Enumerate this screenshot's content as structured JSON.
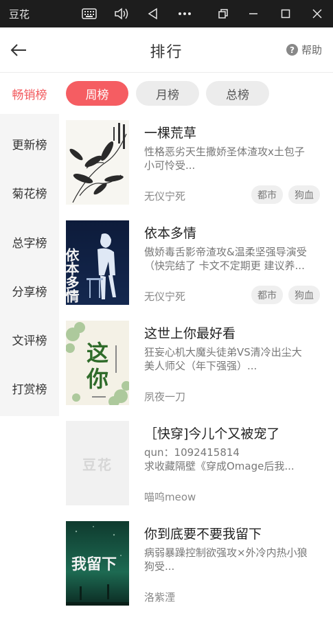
{
  "emulator": {
    "app_name": "豆花"
  },
  "header": {
    "title": "排行",
    "help_label": "帮助"
  },
  "sidebar": {
    "items": [
      {
        "label": "畅销榜",
        "active": true
      },
      {
        "label": "更新榜"
      },
      {
        "label": "菊花榜"
      },
      {
        "label": "总字榜"
      },
      {
        "label": "分享榜"
      },
      {
        "label": "文评榜"
      },
      {
        "label": "打赏榜"
      }
    ]
  },
  "tabs": [
    {
      "label": "周榜",
      "active": true
    },
    {
      "label": "月榜"
    },
    {
      "label": "总榜"
    }
  ],
  "books": [
    {
      "title": "一棵荒草",
      "desc_line1": "性格恶劣天生撒娇圣体渣攻x土包子",
      "desc_line2": "小可怜受...",
      "author": "无仪宁死",
      "tags": [
        "都市",
        "狗血"
      ]
    },
    {
      "title": "依本多情",
      "desc_line1": "傲娇毒舌影帝渣攻&温柔坚强导演受",
      "desc_line2": "（快完结了 卡文不定期更 建议养...",
      "author": "无仪宁死",
      "tags": [
        "都市",
        "狗血"
      ],
      "cover_text": "依本多情"
    },
    {
      "title": "这世上你最好看",
      "desc_line1": "狂妄心机大魔头徒弟VS清冷出尘大",
      "desc_line2": "美人师父（年下强强）...",
      "author": "夙夜一刀",
      "tags": [],
      "cover_text": "这世上你最好看"
    },
    {
      "title": "［快穿]今儿个又被宠了",
      "desc_line1": "    qun：1092415814",
      "desc_line2": "    求收藏隔壁《穿成Omage后我...",
      "author": "喵呜meow",
      "tags": [],
      "cover_text": "豆花"
    },
    {
      "title": "你到底要不要我留下",
      "desc_line1": "病弱暴躁控制欲强攻×外冷内热小狼",
      "desc_line2": "狗受...",
      "author": "洛紫湮",
      "tags": [],
      "cover_text": "我留下"
    }
  ],
  "colors": {
    "accent": "#f55d62",
    "sidebar_bg": "#f5f5f5",
    "topbar_bg": "#1d1d1d"
  }
}
